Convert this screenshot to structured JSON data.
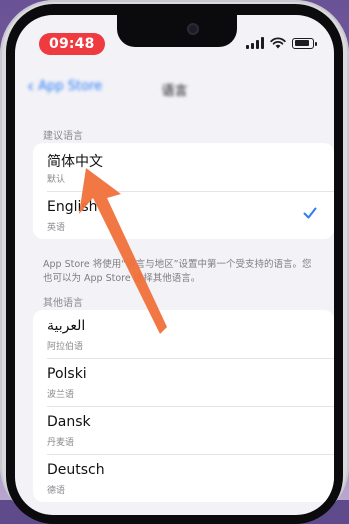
{
  "status": {
    "time": "09:48"
  },
  "nav": {
    "back_label": "App Store",
    "title": "语言"
  },
  "suggested": {
    "header": "建议语言",
    "items": [
      {
        "title": "简体中文",
        "subtitle": "默认",
        "selected": false
      },
      {
        "title": "English",
        "subtitle": "英语",
        "selected": true
      }
    ]
  },
  "footnote": "App Store 将使用“语言与地区”设置中第一个受支持的语言。您也可以为 App Store 选择其他语言。",
  "other": {
    "header": "其他语言",
    "items": [
      {
        "title": "العربية",
        "subtitle": "阿拉伯语"
      },
      {
        "title": "Polski",
        "subtitle": "波兰语"
      },
      {
        "title": "Dansk",
        "subtitle": "丹麦语"
      },
      {
        "title": "Deutsch",
        "subtitle": "德语"
      }
    ]
  },
  "colors": {
    "accent": "#2d7cf6",
    "arrow": "#f0703a",
    "time_pill": "#ef3a3f"
  }
}
